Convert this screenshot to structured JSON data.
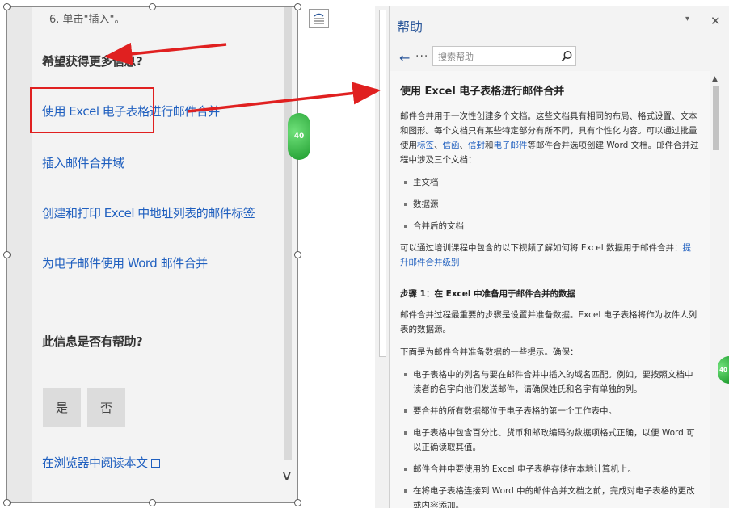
{
  "left_image": {
    "top_fragment": "6. 单击\"插入\"。",
    "more_info_heading": "希望获得更多信息?",
    "links": [
      "使用 Excel 电子表格进行邮件合并",
      "插入邮件合并域",
      "创建和打印 Excel 中地址列表的邮件标签",
      "为电子邮件使用 Word 邮件合并"
    ],
    "helpful_heading": "此信息是否有帮助?",
    "yes_label": "是",
    "no_label": "否",
    "read_in_browser": "在浏览器中阅读本文",
    "scroll_down": "∨",
    "bubble_text": "40"
  },
  "help_pane": {
    "title": "帮助",
    "dropdown_glyph": "▾",
    "close_glyph": "✕",
    "back_glyph": "←",
    "more_glyph": "···",
    "search_placeholder": "搜索帮助",
    "article": {
      "title": "使用 Excel 电子表格进行邮件合并",
      "intro_part1": "邮件合并用于一次性创建多个文档。这些文档具有相同的布局、格式设置、文本和图形。每个文档只有某些特定部分有所不同，具有个性化内容。可以通过批量使用",
      "intro_link1": "标签",
      "intro_sep1": "、",
      "intro_link2": "信函",
      "intro_sep2": "、",
      "intro_link3": "信封",
      "intro_and": "和",
      "intro_link4": "电子邮件",
      "intro_part2": "等邮件合并选项创建 Word 文档。邮件合并过程中涉及三个文档：",
      "doc_items": [
        "主文档",
        "数据源",
        "合并后的文档"
      ],
      "video_text": "可以通过培训课程中包含的以下视频了解如何将 Excel 数据用于邮件合并：",
      "video_link": "提升邮件合并级别",
      "step1_title": "步骤 1：在 Excel 中准备用于邮件合并的数据",
      "step1_p": "邮件合并过程最重要的步骤是设置并准备数据。Excel 电子表格将作为收件人列表的数据源。",
      "tips_intro": "下面是为邮件合并准备数据的一些提示。确保：",
      "tips": [
        "电子表格中的列名与要在邮件合并中插入的域名匹配。例如，要按照文档中读者的名字向他们发送邮件，请确保姓氏和名字有单独的列。",
        "要合并的所有数据都位于电子表格的第一个工作表中。",
        "电子表格中包含百分比、货币和邮政编码的数据项格式正确，以便 Word 可以正确读取其值。",
        "邮件合并中要使用的 Excel 电子表格存储在本地计算机上。",
        "在将电子表格连接到 Word 中的邮件合并文档之前，完成对电子表格的更改或内容添加。"
      ]
    },
    "scroll_up": "▲",
    "bubble_text": "40"
  },
  "colors": {
    "annotation_red": "#e02020",
    "link_blue": "#1f5fbf",
    "title_blue": "#2b579a"
  }
}
